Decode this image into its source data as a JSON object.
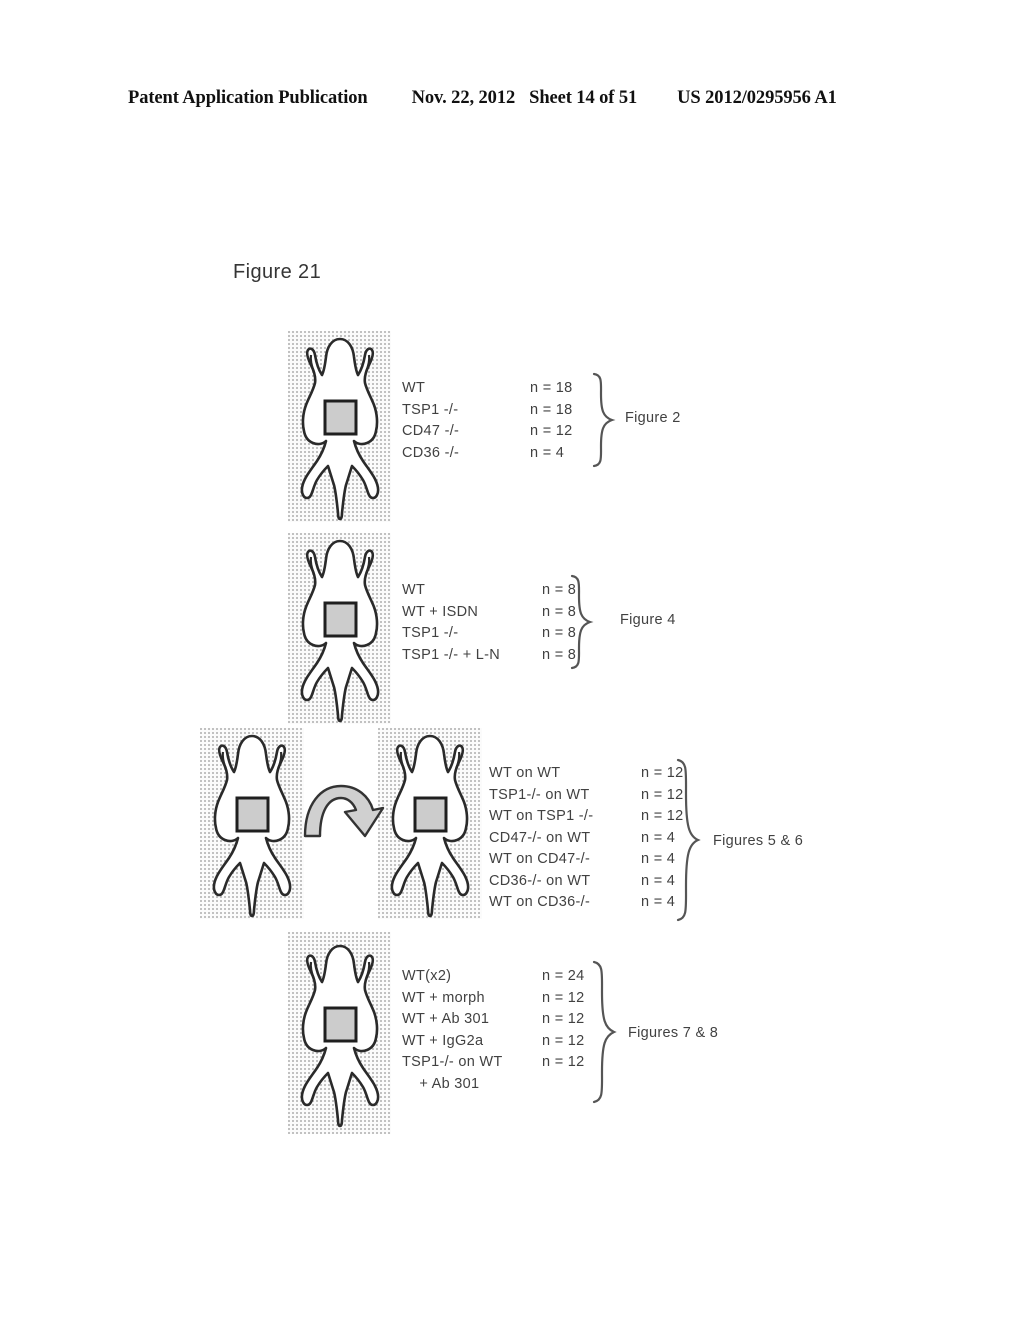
{
  "page_header": {
    "publication": "Patent Application Publication",
    "date": "Nov. 22, 2012",
    "sheet": "Sheet 14 of 51",
    "publication_number": "US 2012/0295956 A1"
  },
  "figure": {
    "title": "Figure 21",
    "diagram_type": "experimental-design-schematic",
    "colors": {
      "ink": "#3a3a3a",
      "outline": "#2a2a2a",
      "panel_background": "#fbfbfb",
      "stipple": "#787878",
      "window_fill": "#c9c9c9"
    }
  },
  "groups": [
    {
      "id": "group-1",
      "mice_count": 1,
      "has_transfer_arrow": false,
      "rows": [
        {
          "condition": "WT",
          "n": "n = 18"
        },
        {
          "condition": "TSP1 -/-",
          "n": "n = 18"
        },
        {
          "condition": "CD47 -/-",
          "n": "n = 12"
        },
        {
          "condition": "CD36 -/-",
          "n": "n = 4"
        }
      ],
      "figure_reference": "Figure 2"
    },
    {
      "id": "group-2",
      "mice_count": 1,
      "has_transfer_arrow": false,
      "rows": [
        {
          "condition": "WT",
          "n": "n = 8"
        },
        {
          "condition": "WT + ISDN",
          "n": "n = 8"
        },
        {
          "condition": "TSP1 -/-",
          "n": "n = 8"
        },
        {
          "condition": "TSP1 -/- + L-N",
          "n": "n = 8"
        }
      ],
      "figure_reference": "Figure 4"
    },
    {
      "id": "group-3",
      "mice_count": 2,
      "has_transfer_arrow": true,
      "rows": [
        {
          "condition": "WT on WT",
          "n": "n = 12"
        },
        {
          "condition": "TSP1-/- on WT",
          "n": "n = 12"
        },
        {
          "condition": "WT on TSP1 -/-",
          "n": "n = 12"
        },
        {
          "condition": "CD47-/- on WT",
          "n": "n = 4"
        },
        {
          "condition": "WT on CD47-/-",
          "n": "n = 4"
        },
        {
          "condition": "CD36-/- on WT",
          "n": "n = 4"
        },
        {
          "condition": "WT on CD36-/-",
          "n": "n = 4"
        }
      ],
      "figure_reference": "Figures 5 & 6"
    },
    {
      "id": "group-4",
      "mice_count": 1,
      "has_transfer_arrow": false,
      "rows": [
        {
          "condition": "WT(x2)",
          "n": "n = 24"
        },
        {
          "condition": "WT + morph",
          "n": "n = 12"
        },
        {
          "condition": "WT + Ab 301",
          "n": "n = 12"
        },
        {
          "condition": "WT + IgG2a",
          "n": "n = 12"
        },
        {
          "condition": "TSP1-/- on WT",
          "n": "n = 12"
        },
        {
          "condition": "    + Ab 301",
          "n": ""
        }
      ],
      "figure_reference": "Figures 7 & 8"
    }
  ]
}
